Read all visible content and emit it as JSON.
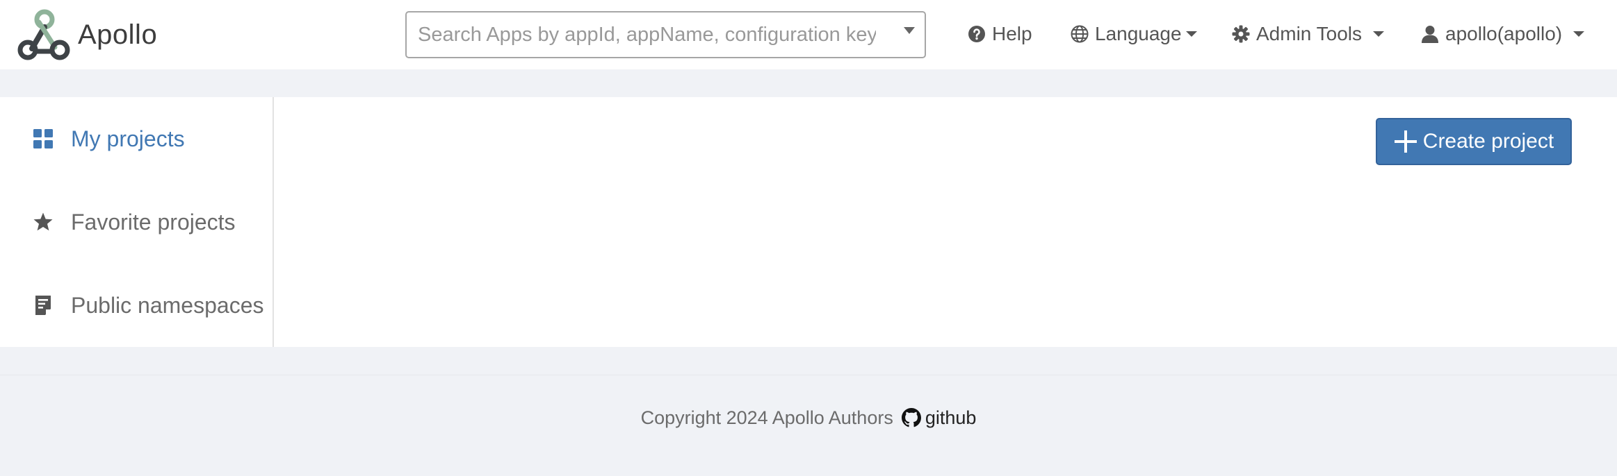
{
  "brand": {
    "name": "Apollo",
    "logo_icon": "apollo-logo"
  },
  "search": {
    "placeholder": "Search Apps by appId, appName, configuration key",
    "value": ""
  },
  "nav": {
    "help": {
      "label": "Help",
      "icon": "question-circle-icon"
    },
    "language": {
      "label": "Language",
      "icon": "globe-icon"
    },
    "admin_tools": {
      "label": "Admin Tools",
      "icon": "gear-icon"
    },
    "user": {
      "label": "apollo(apollo)",
      "icon": "user-icon"
    }
  },
  "sidebar": {
    "items": [
      {
        "label": "My projects",
        "icon": "grid-icon",
        "active": true
      },
      {
        "label": "Favorite projects",
        "icon": "star-icon",
        "active": false
      },
      {
        "label": "Public namespaces",
        "icon": "document-icon",
        "active": false
      }
    ]
  },
  "main": {
    "create_label": "Create project",
    "create_icon": "plus-icon"
  },
  "footer": {
    "copyright": "Copyright 2024 Apollo Authors",
    "link_label": "github",
    "link_icon": "github-icon"
  },
  "colors": {
    "accent": "#4178b3",
    "background": "#f0f2f6",
    "text": "#6b6b6b"
  }
}
